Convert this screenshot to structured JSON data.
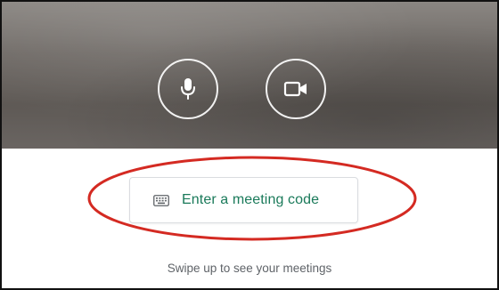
{
  "icons": {
    "microphone": "mic-icon",
    "camera": "video-camera-icon",
    "keyboard": "keyboard-icon"
  },
  "meeting": {
    "code_button_label": "Enter a meeting code"
  },
  "footer": {
    "hint": "Swipe up to see your meetings"
  },
  "colors": {
    "accent_text": "#1a7a5a",
    "annotation": "#d42a22",
    "preview_dark": "#5e5955",
    "hint_text": "#5f6368"
  }
}
